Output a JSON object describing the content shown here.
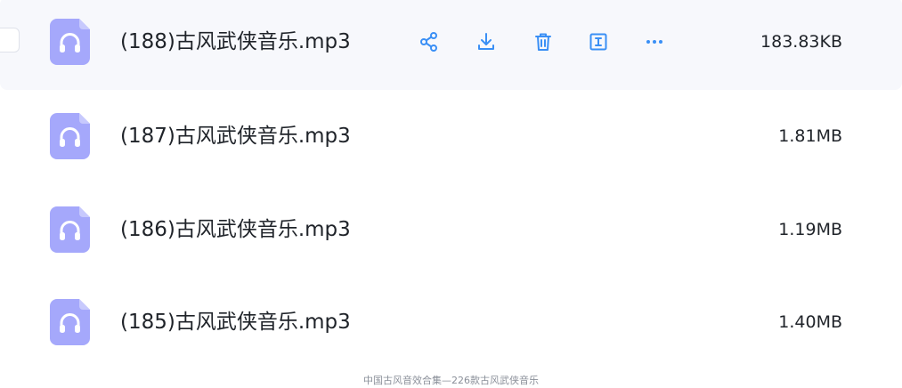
{
  "files": [
    {
      "name": "(188)古风武侠音乐.mp3",
      "size": "183.83KB"
    },
    {
      "name": "(187)古风武侠音乐.mp3",
      "size": "1.81MB"
    },
    {
      "name": "(186)古风武侠音乐.mp3",
      "size": "1.19MB"
    },
    {
      "name": "(185)古风武侠音乐.mp3",
      "size": "1.40MB"
    }
  ],
  "icons": {
    "file": "headphones-file-icon",
    "share": "share-icon",
    "download": "download-icon",
    "delete": "trash-icon",
    "rename": "rename-icon",
    "more": "more-icon"
  },
  "colors": {
    "file_icon": "#a5a8fb",
    "action_icon": "#3a8ff5",
    "hover_row": "#f7f8fc"
  },
  "footer": {
    "text": "中国古风音效合集—226款古风武侠音乐"
  }
}
